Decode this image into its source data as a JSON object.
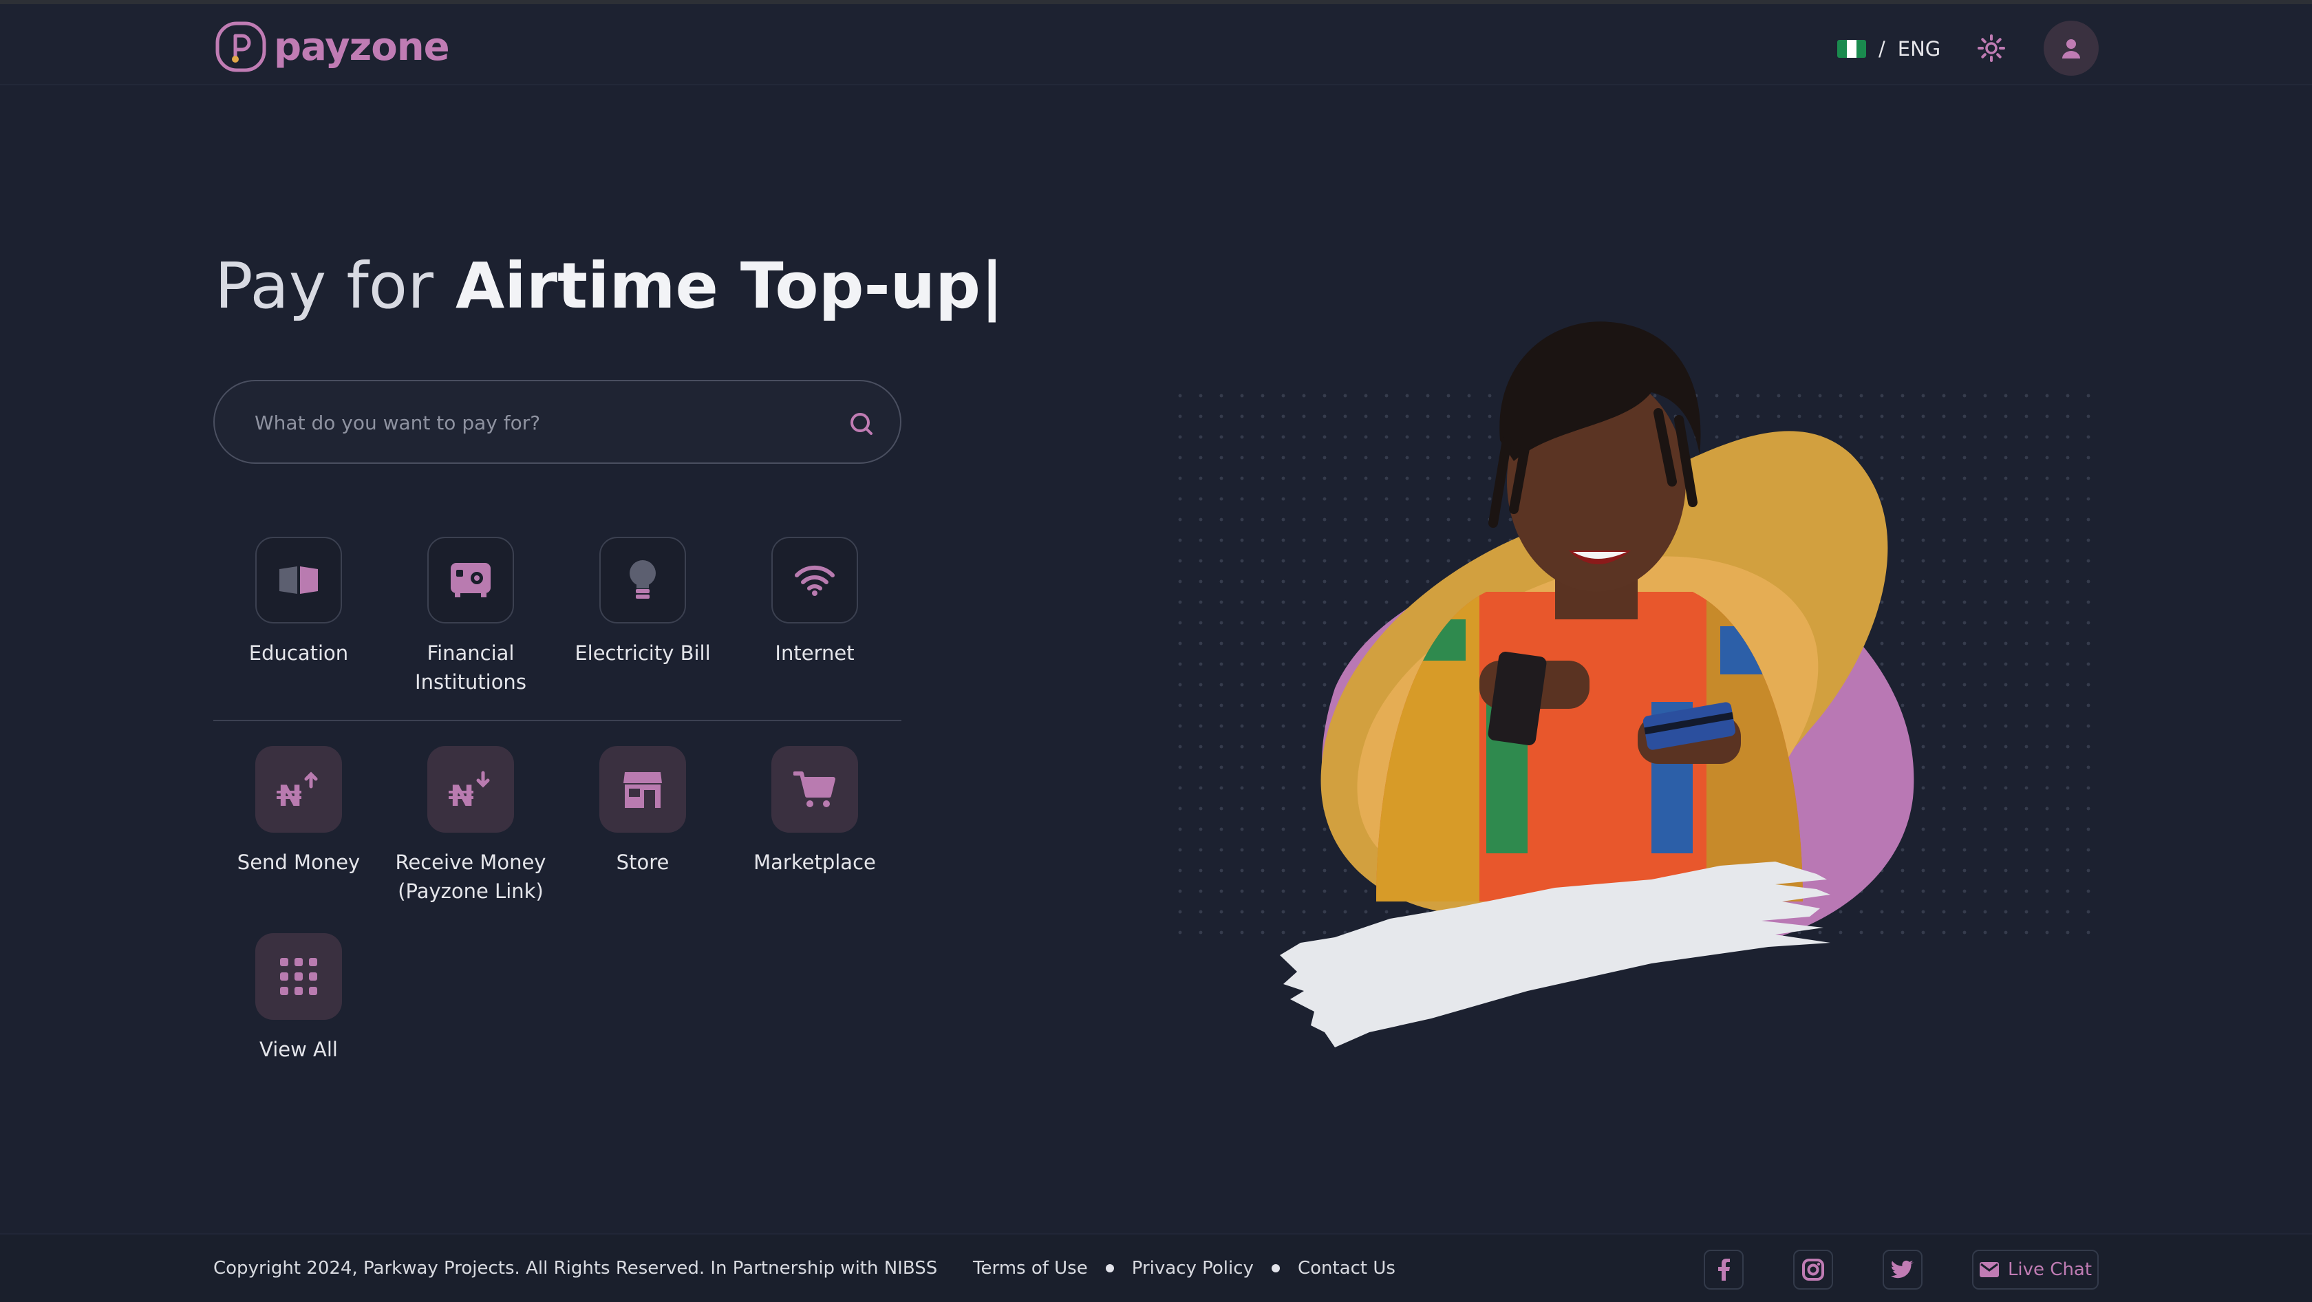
{
  "header": {
    "brand": "payzone",
    "language_separator": "/",
    "language": "ENG",
    "flag_colors": [
      "#1a8a4e",
      "#ffffff",
      "#1a8a4e"
    ],
    "icons": [
      "settings-icon",
      "user-icon"
    ]
  },
  "hero": {
    "title_light": "Pay for",
    "title_bold": "Airtime Top-up|"
  },
  "search": {
    "placeholder": "What do you want to pay for?"
  },
  "categories": [
    {
      "label": "Education",
      "icon": "book-icon"
    },
    {
      "label": "Financial Institutions",
      "icon": "safe-icon"
    },
    {
      "label": "Electricity Bill",
      "icon": "lightbulb-icon"
    },
    {
      "label": "Internet",
      "icon": "wifi-icon"
    }
  ],
  "services": [
    {
      "label": "Send Money",
      "icon": "naira-send-icon"
    },
    {
      "label": "Receive Money (Payzone Link)",
      "icon": "naira-receive-icon"
    },
    {
      "label": "Store",
      "icon": "store-icon"
    },
    {
      "label": "Marketplace",
      "icon": "cart-icon"
    }
  ],
  "view_all": {
    "label": "View All",
    "icon": "grid-icon"
  },
  "footer": {
    "copyright": "Copyright 2024, Parkway Projects. All Rights Reserved. In Partnership with NIBSS",
    "links": [
      "Terms of Use",
      "Privacy Policy",
      "Contact Us"
    ],
    "social": [
      "facebook-icon",
      "instagram-icon",
      "twitter-icon"
    ],
    "live_chat": "Live Chat"
  },
  "colors": {
    "background": "#1c2130",
    "accent": "#c07cb4",
    "tile_dark": "#1a1e2b",
    "tile_purple": "#3a3040",
    "blob_yellow": "#e2a849",
    "blob_purple": "#b978b4"
  }
}
